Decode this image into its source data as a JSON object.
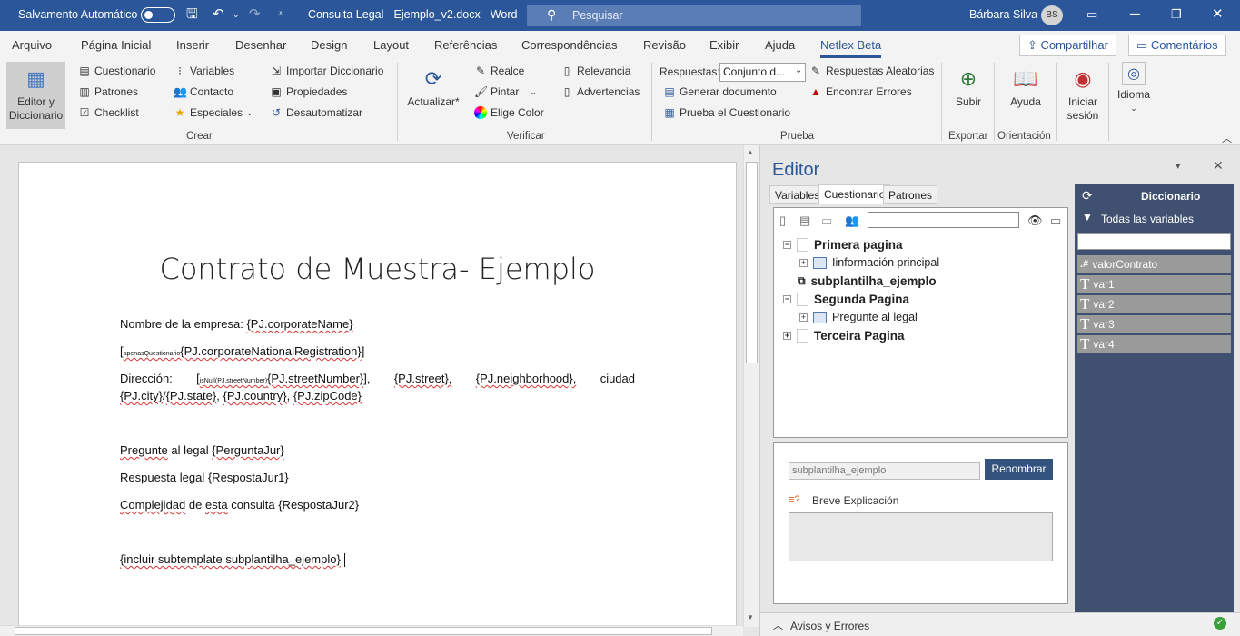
{
  "titlebar": {
    "autosave_label": "Salvamento Automático",
    "doc_title": "Consulta Legal - Ejemplo_v2.docx - Word",
    "search_placeholder": "Pesquisar",
    "user_name": "Bárbara Silva",
    "user_initials": "BS"
  },
  "tabs": [
    "Arquivo",
    "Página Inicial",
    "Inserir",
    "Desenhar",
    "Design",
    "Layout",
    "Referências",
    "Correspondências",
    "Revisão",
    "Exibir",
    "Ajuda",
    "Netlex Beta"
  ],
  "share": {
    "share_label": "Compartilhar",
    "comments_label": "Comentários"
  },
  "ribbon": {
    "editor_label": "Editor y Diccionario",
    "crear": {
      "col1": [
        "Cuestionario",
        "Patrones",
        "Checklist"
      ],
      "col2": [
        "Variables",
        "Contacto",
        "Especiales"
      ],
      "col3": [
        "Importar Diccionario",
        "Propiedades",
        "Desautomatizar"
      ],
      "group_label": "Crear"
    },
    "verificar": {
      "actualizar": "Actualizar*",
      "col1": [
        "Realce",
        "Pintar",
        "Elige Color"
      ],
      "col2": [
        "Relevancia",
        "Advertencias"
      ],
      "group_label": "Verificar"
    },
    "prueba": {
      "respuestas_label": "Respuestas:",
      "respuestas_value": "Conjunto d...",
      "items": [
        "Respuestas Aleatorias",
        "Generar documento",
        "Encontrar Errores",
        "Prueba el Cuestionario"
      ],
      "group_label": "Prueba"
    },
    "subir": "Subir",
    "exportar_label": "Exportar",
    "ayuda": "Ayuda",
    "orientacion_label": "Orientación",
    "iniciar": "Iniciar sesión",
    "idioma": "Idioma"
  },
  "document": {
    "title": "Contrato de Muestra- Ejemplo",
    "empresa_label": "Nombre de la empresa:",
    "empresa_var": "{PJ.corporateName}",
    "reg_tiny": "apenasQuestionario",
    "reg_var": "{PJ.corporateNationalRegistration}",
    "dir_label": "Dirección:",
    "dir_tiny": "isNull(PJ.streetNumber)",
    "dir_num": "{PJ.streetNumber}",
    "dir_street": "{PJ.street},",
    "dir_neigh": "{PJ.neighborhood},",
    "dir_ciudad": "ciudad",
    "dir_city": "{PJ.city}",
    "dir_state": "{PJ.state}",
    "dir_country": "{PJ.country}",
    "dir_zip": "{PJ.zipCode}",
    "pregunta_word": "Pregunte",
    "pregunta_rest": "al legal",
    "pregunta_var": "{PerguntaJur}",
    "respuesta_line": "Respuesta legal {RespostaJur1}",
    "complejidad_word": "Complejidad",
    "complejidad_de": "de",
    "complejidad_esta": "esta",
    "complejidad_rest": "consulta {RespostaJur2}",
    "incluir_line": "{incluir subtemplate subplantilha_ejemplo}"
  },
  "panel": {
    "title": "Editor",
    "tabs": [
      "Variables",
      "Cuestionario",
      "Patrones"
    ],
    "tree": {
      "n1": "Primera pagina",
      "n1a": "Iinformación principal",
      "n1b": "subplantilha_ejemplo",
      "n2": "Segunda Pagina",
      "n2a": "Pregunte al legal",
      "n3": "Terceira Pagina"
    },
    "name_value": "subplantilha_ejemplo",
    "rename_label": "Renombrar",
    "breve_label": "Breve Explicación",
    "status_label": "Avisos y Errores"
  },
  "dictionary": {
    "title": "Diccionario",
    "filter_label": "Todas las variables",
    "items": [
      {
        "icon": ".#",
        "name": "valorContrato"
      },
      {
        "icon": "T",
        "name": "var1"
      },
      {
        "icon": "T",
        "name": "var2"
      },
      {
        "icon": "T",
        "name": "var3"
      },
      {
        "icon": "T",
        "name": "var4"
      }
    ]
  },
  "colors": {
    "accent": "#2b579a",
    "dict_bg": "#405070"
  }
}
